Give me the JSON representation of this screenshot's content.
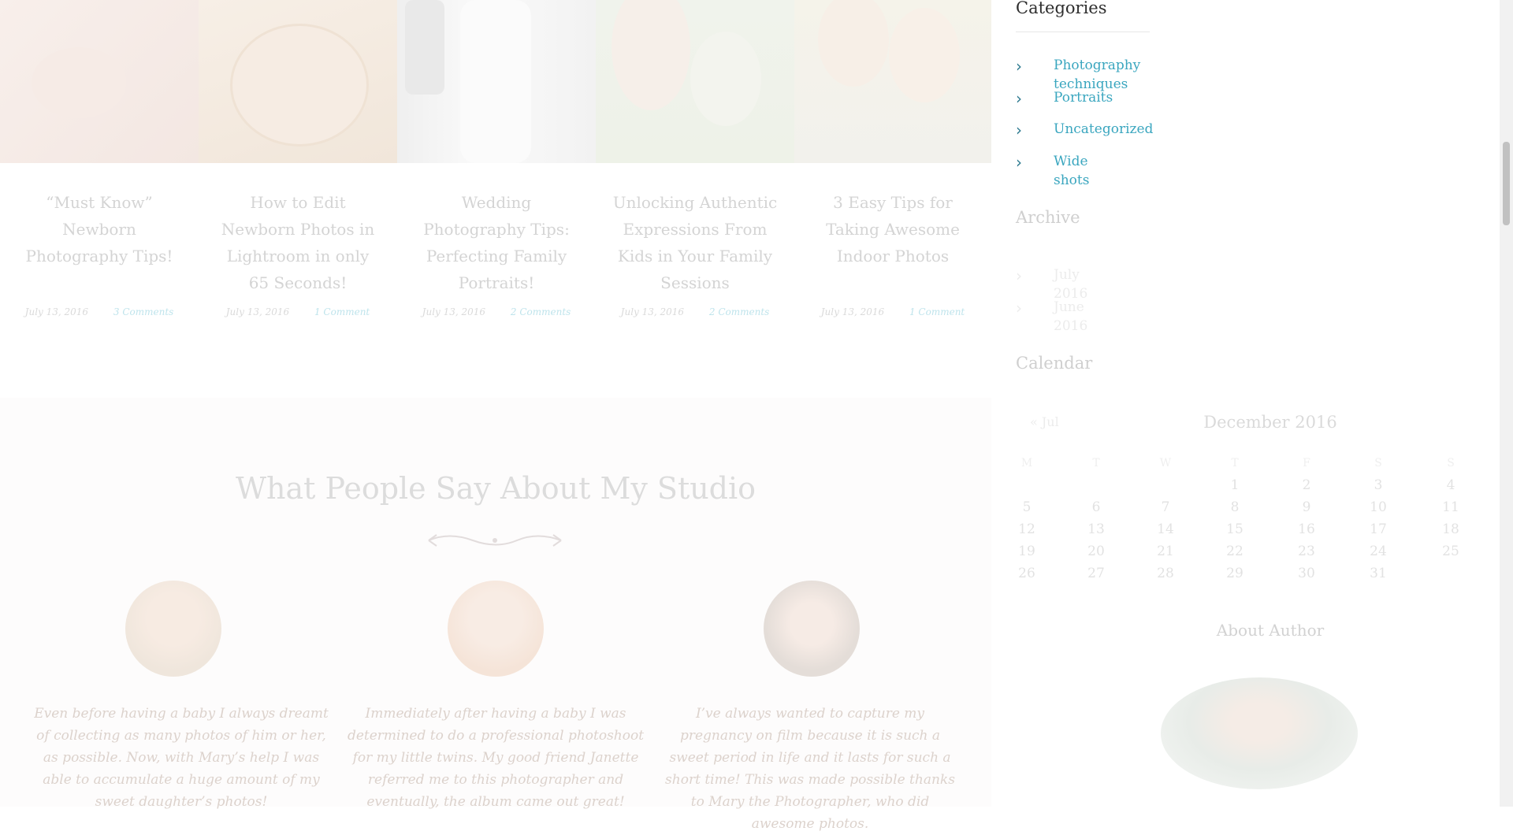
{
  "posts": [
    {
      "title": "“Must Know” Newborn Photography Tips!",
      "date": "July 13, 2016",
      "comments": "3 Comments"
    },
    {
      "title": "How to Edit Newborn Photos in Lightroom in only 65 Seconds!",
      "date": "July 13, 2016",
      "comments": "1 Comment"
    },
    {
      "title": "Wedding Photography Tips: Perfecting Family Portraits!",
      "date": "July 13, 2016",
      "comments": "2 Comments"
    },
    {
      "title": "Unlocking Authentic Expressions From Kids in Your Family Sessions",
      "date": "July 13, 2016",
      "comments": "2 Comments"
    },
    {
      "title": "3 Easy Tips for Taking Awesome Indoor Photos",
      "date": "July 13, 2016",
      "comments": "1 Comment"
    }
  ],
  "testimonials": {
    "heading": "What People Say About My Studio",
    "items": [
      {
        "quote": "Even before having a baby I always dreamt of collecting as many photos of him or her, as possible. Now, with Mary’s help I was able to accumulate a huge amount of my sweet daughter’s photos!"
      },
      {
        "quote": "Immediately after having a baby I was determined to do a professional photoshoot for my little twins. My good friend Janette referred me to this photographer and eventually, the album came out great!"
      },
      {
        "quote": "I’ve always wanted to capture my pregnancy on film because it is such a sweet period in life and it lasts for such a short time! This was made possible thanks to Mary the Photographer, who did awesome photos."
      }
    ]
  },
  "sidebar": {
    "categories": {
      "title": "Categories",
      "items": [
        "Photography techniques",
        "Portraits",
        "Uncategorized",
        "Wide shots"
      ]
    },
    "archive": {
      "title": "Archive",
      "items": [
        "July 2016",
        "June 2016"
      ]
    },
    "calendar": {
      "title": "Calendar",
      "caption": "December 2016",
      "prev": "« Jul",
      "weekdays": [
        "M",
        "T",
        "W",
        "T",
        "F",
        "S",
        "S"
      ],
      "weeks": [
        [
          "",
          "",
          "",
          "1",
          "2",
          "3",
          "4"
        ],
        [
          "5",
          "6",
          "7",
          "8",
          "9",
          "10",
          "11"
        ],
        [
          "12",
          "13",
          "14",
          "15",
          "16",
          "17",
          "18"
        ],
        [
          "19",
          "20",
          "21",
          "22",
          "23",
          "24",
          "25"
        ],
        [
          "26",
          "27",
          "28",
          "29",
          "30",
          "31",
          ""
        ]
      ]
    },
    "about": {
      "title": "About Author"
    }
  },
  "icons": {
    "list_bullet": "chevron-right-icon"
  },
  "colors": {
    "link": "#3aa6bf",
    "bullet": "#2e7a90",
    "heading": "#2e2e2e"
  }
}
